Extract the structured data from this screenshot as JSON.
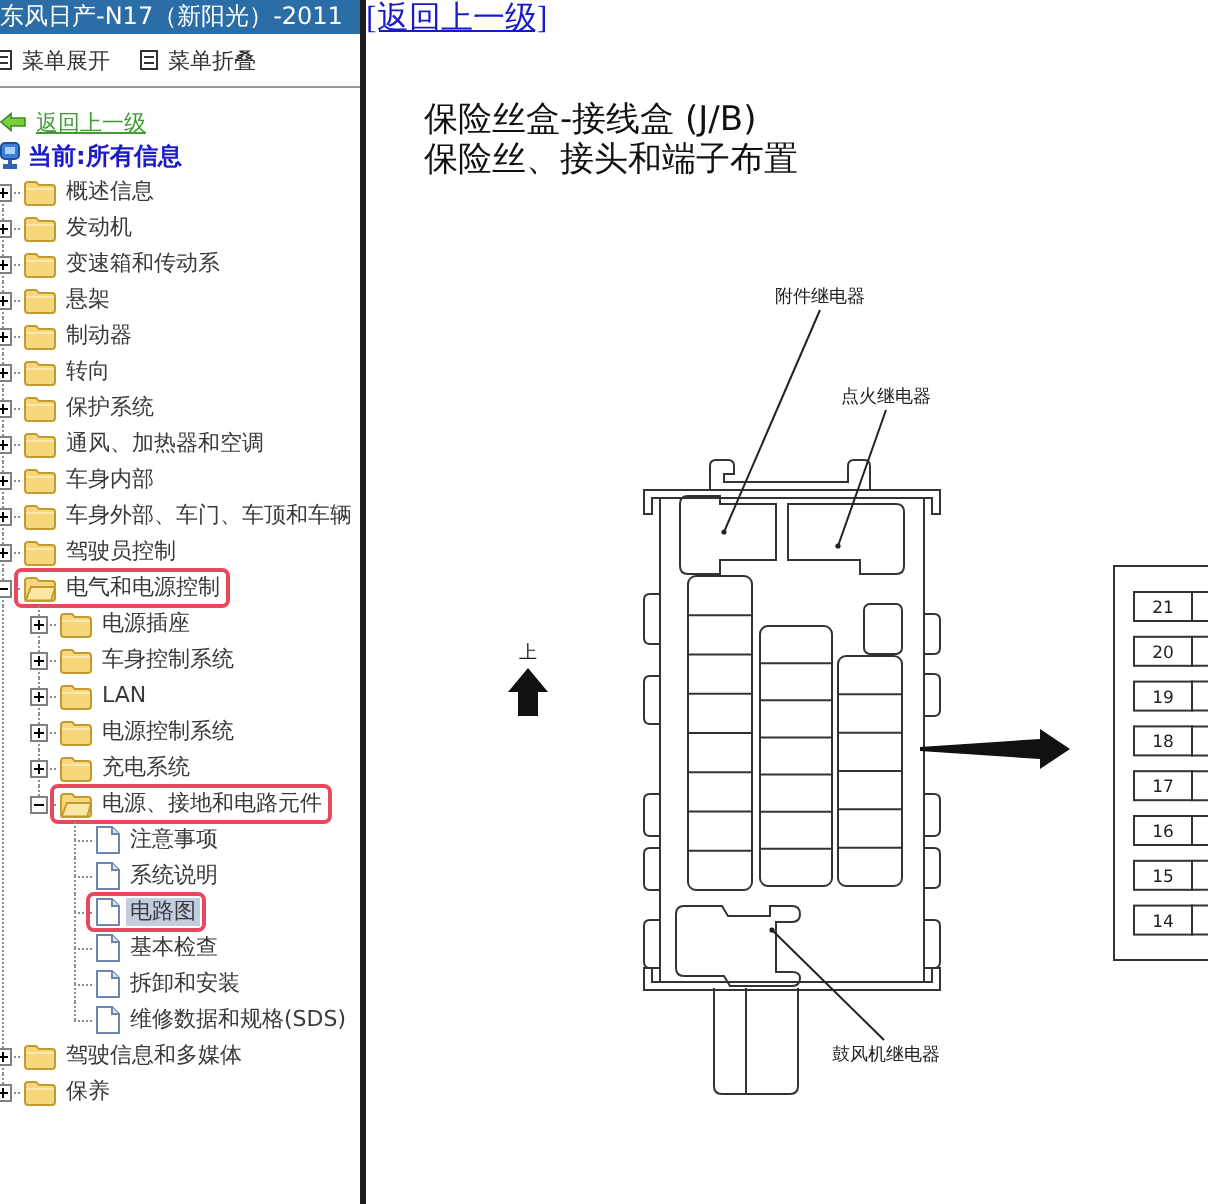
{
  "sidebar": {
    "title": "东风日产-N17（新阳光）-2011",
    "menu_buttons": [
      "菜单展开",
      "菜单折叠"
    ],
    "back_link": "返回上一级",
    "current_location": "当前:所有信息",
    "tree": [
      {
        "label": "概述信息",
        "kind": "folder",
        "expanded": false,
        "selected": false,
        "marked": false
      },
      {
        "label": "发动机",
        "kind": "folder",
        "expanded": false,
        "selected": false,
        "marked": false
      },
      {
        "label": "变速箱和传动系",
        "kind": "folder",
        "expanded": false,
        "selected": false,
        "marked": false
      },
      {
        "label": "悬架",
        "kind": "folder",
        "expanded": false,
        "selected": false,
        "marked": false
      },
      {
        "label": "制动器",
        "kind": "folder",
        "expanded": false,
        "selected": false,
        "marked": false
      },
      {
        "label": "转向",
        "kind": "folder",
        "expanded": false,
        "selected": false,
        "marked": false
      },
      {
        "label": "保护系统",
        "kind": "folder",
        "expanded": false,
        "selected": false,
        "marked": false
      },
      {
        "label": "通风、加热器和空调",
        "kind": "folder",
        "expanded": false,
        "selected": false,
        "marked": false
      },
      {
        "label": "车身内部",
        "kind": "folder",
        "expanded": false,
        "selected": false,
        "marked": false
      },
      {
        "label": "车身外部、车门、车顶和车辆",
        "kind": "folder",
        "expanded": false,
        "selected": false,
        "marked": false
      },
      {
        "label": "驾驶员控制",
        "kind": "folder",
        "expanded": false,
        "selected": false,
        "marked": false
      },
      {
        "label": "电气和电源控制",
        "kind": "folder",
        "expanded": true,
        "selected": false,
        "marked": true,
        "children": [
          {
            "label": "电源插座",
            "kind": "folder",
            "expanded": false,
            "selected": false,
            "marked": false
          },
          {
            "label": "车身控制系统",
            "kind": "folder",
            "expanded": false,
            "selected": false,
            "marked": false
          },
          {
            "label": "LAN",
            "kind": "folder",
            "expanded": false,
            "selected": false,
            "marked": false
          },
          {
            "label": "电源控制系统",
            "kind": "folder",
            "expanded": false,
            "selected": false,
            "marked": false
          },
          {
            "label": "充电系统",
            "kind": "folder",
            "expanded": false,
            "selected": false,
            "marked": false
          },
          {
            "label": "电源、接地和电路元件",
            "kind": "folder",
            "expanded": true,
            "selected": false,
            "marked": true,
            "children": [
              {
                "label": "注意事项",
                "kind": "page",
                "selected": false,
                "marked": false
              },
              {
                "label": "系统说明",
                "kind": "page",
                "selected": false,
                "marked": false
              },
              {
                "label": "电路图",
                "kind": "page",
                "selected": true,
                "marked": true
              },
              {
                "label": "基本检查",
                "kind": "page",
                "selected": false,
                "marked": false
              },
              {
                "label": "拆卸和安装",
                "kind": "page",
                "selected": false,
                "marked": false
              },
              {
                "label": "维修数据和规格(SDS)",
                "kind": "page",
                "selected": false,
                "marked": false
              }
            ]
          }
        ]
      },
      {
        "label": "驾驶信息和多媒体",
        "kind": "folder",
        "expanded": false,
        "selected": false,
        "marked": false
      },
      {
        "label": "保养",
        "kind": "folder",
        "expanded": false,
        "selected": false,
        "marked": false
      }
    ]
  },
  "content": {
    "back_link": "[返回上一级]",
    "title_lines": [
      "保险丝盒-接线盒 (J/B)",
      "保险丝、接头和端子布置"
    ],
    "diagram": {
      "callouts": [
        "附件继电器",
        "点火继电器",
        "鼓风机继电器"
      ],
      "orientation_label": "上",
      "fuse_numbers": [
        "21",
        "20",
        "19",
        "18",
        "17",
        "16",
        "15",
        "14"
      ]
    }
  }
}
